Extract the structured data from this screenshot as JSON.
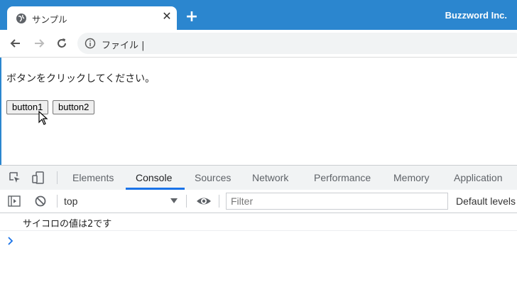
{
  "browser": {
    "tab_title": "サンプル",
    "brand": "Buzzword Inc.",
    "address": "ファイル |"
  },
  "page": {
    "instruction": "ボタンをクリックしてください。",
    "button1": "button1",
    "button2": "button2"
  },
  "devtools": {
    "tabs": [
      "Elements",
      "Console",
      "Sources",
      "Network",
      "Performance",
      "Memory",
      "Application"
    ],
    "active_tab": "Console",
    "context": "top",
    "filter_placeholder": "Filter",
    "levels": "Default levels",
    "log": "サイコロの値は2です"
  },
  "colors": {
    "titlebar": "#2b86cf",
    "active_tab_underline": "#1a73e8"
  }
}
